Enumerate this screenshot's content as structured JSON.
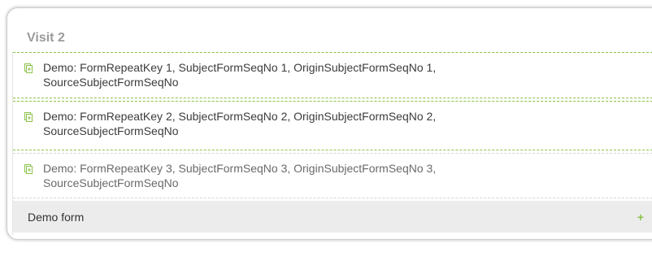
{
  "visit": {
    "title": "Visit 2",
    "forms": [
      {
        "label": "Demo: FormRepeatKey 1, SubjectFormSeqNo 1, OriginSubjectFormSeqNo 1, SourceSubjectFormSeqNo",
        "icon": "form-copy-icon"
      },
      {
        "label": "Demo: FormRepeatKey 2, SubjectFormSeqNo 2, OriginSubjectFormSeqNo 2, SourceSubjectFormSeqNo",
        "icon": "form-copy-icon"
      },
      {
        "label": "Demo: FormRepeatKey 3, SubjectFormSeqNo 3, OriginSubjectFormSeqNo 3, SourceSubjectFormSeqNo",
        "icon": "form-copy-icon"
      }
    ],
    "add_form": {
      "label": "Demo form",
      "add_symbol": "+"
    }
  },
  "colors": {
    "accent": "#8bc34a",
    "title_gray": "#9b9b9b",
    "row_bg": "#ececec"
  }
}
